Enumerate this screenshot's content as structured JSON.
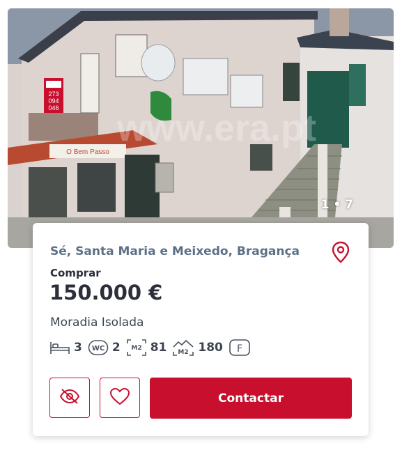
{
  "listing": {
    "photo_counter": "1 • 7",
    "location": "Sé, Santa Maria e Meixedo, Bragança",
    "operation": "Comprar",
    "price": "150.000 €",
    "property_type": "Moradia Isolada",
    "features": {
      "bedrooms": "3",
      "bathrooms": "2",
      "area_gross": "81",
      "area_land": "180",
      "energy_class": "F"
    },
    "contact_label": "Contactar"
  },
  "photo_text": {
    "sign_phone": [
      "273",
      "094",
      "046"
    ],
    "shop_sign": "O Bem Passo",
    "watermark": "www.era.pt"
  },
  "colors": {
    "brand": "#c8102e",
    "location_text": "#5c6f85",
    "text": "#2a2f3a"
  },
  "icons": [
    "bed-icon",
    "wc-icon",
    "m2-area-icon",
    "m2-land-icon",
    "energy-class-icon",
    "map-pin-icon",
    "hide-eye-icon",
    "heart-icon"
  ]
}
